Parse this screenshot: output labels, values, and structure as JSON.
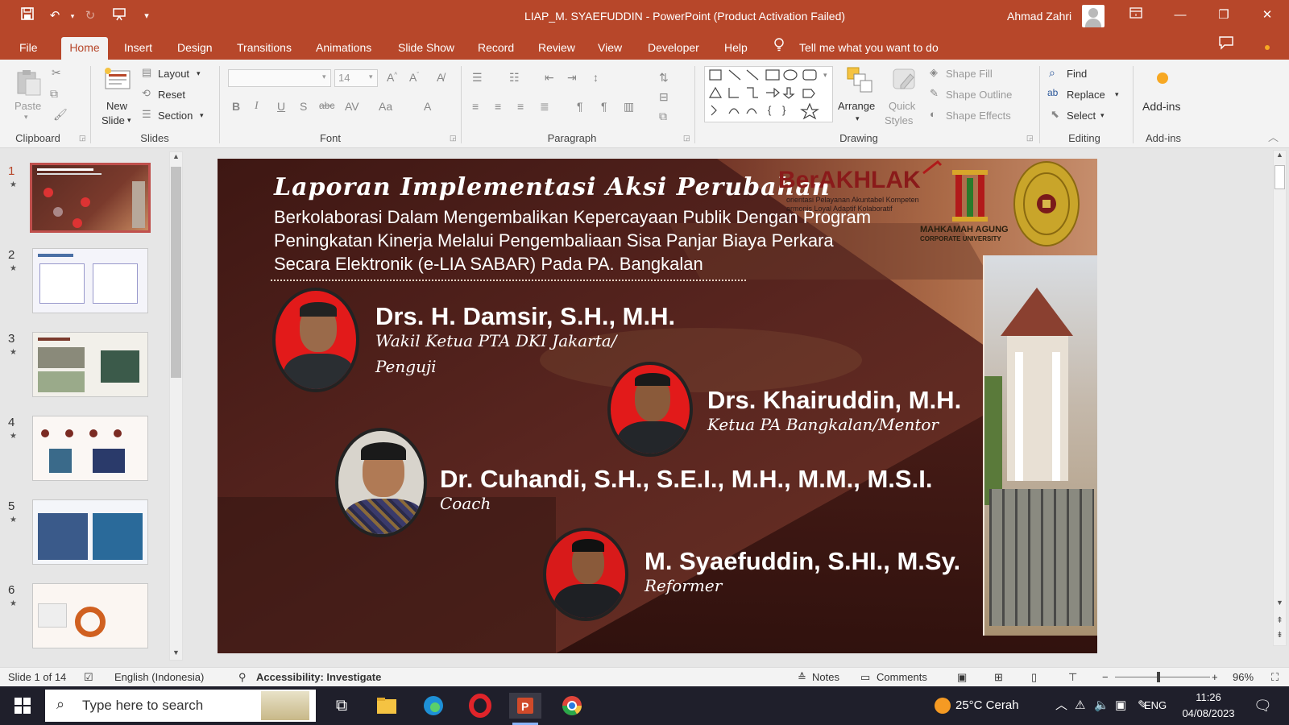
{
  "window": {
    "title": "LIAP_M. SYAEFUDDIN  -  PowerPoint (Product Activation Failed)",
    "user": "Ahmad Zahri"
  },
  "ribbon_tabs": [
    "File",
    "Home",
    "Insert",
    "Design",
    "Transitions",
    "Animations",
    "Slide Show",
    "Record",
    "Review",
    "View",
    "Developer",
    "Help"
  ],
  "tell_me": "Tell me what you want to do",
  "ribbon": {
    "clipboard": {
      "label": "Clipboard",
      "paste": "Paste"
    },
    "slides": {
      "label": "Slides",
      "new_slide": "New",
      "new_slide2": "Slide",
      "layout": "Layout",
      "reset": "Reset",
      "section": "Section"
    },
    "font": {
      "label": "Font",
      "font_size": "14"
    },
    "paragraph": {
      "label": "Paragraph"
    },
    "drawing": {
      "label": "Drawing",
      "arrange": "Arrange",
      "quick": "Quick",
      "styles": "Styles",
      "shape_fill": "Shape Fill",
      "shape_outline": "Shape Outline",
      "shape_effects": "Shape Effects"
    },
    "editing": {
      "label": "Editing",
      "find": "Find",
      "replace": "Replace",
      "select": "Select"
    },
    "addins": {
      "label": "Add-ins",
      "btn": "Add-ins"
    }
  },
  "thumbnails": [
    "1",
    "2",
    "3",
    "4",
    "5",
    "6"
  ],
  "slide": {
    "title": "Laporan Implementasi Aksi Perubahan",
    "subtitle_lines": [
      "Berkolaborasi Dalam Mengembalikan Kepercayaan Publik Dengan Program",
      "Peningkatan Kinerja Melalui Pengembaliaan Sisa Panjar Biaya Perkara",
      "Secara Elektronik (e-LIA SABAR) Pada PA. Bangkalan"
    ],
    "logo_text": "BerAKHLAK",
    "logo_sub1": "orientasi Pelayanan Akuntabel Kompeten",
    "logo_sub2": "armonis Loyal Adaptif Kolaboratif",
    "ma_line1": "MAHKAMAH AGUNG",
    "ma_line2": "CORPORATE UNIVERSITY",
    "people": [
      {
        "name": "Drs. H. Damsir, S.H., M.H.",
        "role1": "Wakil Ketua PTA DKI Jakarta/",
        "role2": "Penguji"
      },
      {
        "name": "Drs. Khairuddin, M.H.",
        "role1": "Ketua PA Bangkalan/Mentor"
      },
      {
        "name": "Dr. Cuhandi, S.H., S.E.I., M.H., M.M., M.S.I.",
        "role1": "Coach"
      },
      {
        "name": "M. Syaefuddin, S.HI., M.Sy.",
        "role1": "Reformer"
      }
    ]
  },
  "status": {
    "slide_of": "Slide 1 of 14",
    "language": "English (Indonesia)",
    "accessibility": "Accessibility: Investigate",
    "notes": "Notes",
    "comments": "Comments",
    "zoom": "96%"
  },
  "taskbar": {
    "search_placeholder": "Type here to search",
    "weather": "25°C  Cerah",
    "lang": "ENG",
    "time": "11:26",
    "date": "04/08/2023"
  }
}
